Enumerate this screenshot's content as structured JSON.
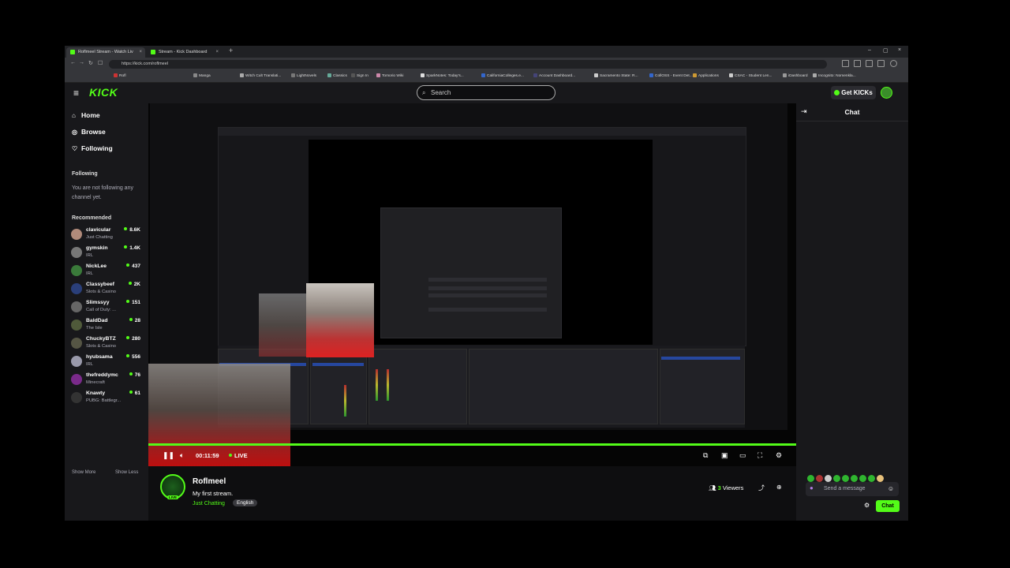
{
  "browser": {
    "tabs": [
      {
        "label": "Roflmeel Stream - Watch Liv"
      },
      {
        "label": "Stream - Kick Dashboard"
      }
    ],
    "new_tab": "+",
    "url": "https://kick.com/roflmeel",
    "window_controls": {
      "minimize": "–",
      "maximize": "▢",
      "close": "×"
    },
    "bookmarks": [
      "Rofl",
      "Manga",
      "Witch Cult Translati...",
      "LightNovels",
      "Classics",
      "Sign In",
      "Tomorio Wiki",
      "SparkNotes: Today's...",
      "CaliforniaColleges.e...",
      "Account Dashboard...",
      "Sacramento State: R...",
      "CollOSS - Event Det...",
      "Applications",
      "CSAC - Student Len...",
      "iDashboard",
      "Incognito: Nomenkla..."
    ]
  },
  "header": {
    "logo": "KICK",
    "search_placeholder": "Search",
    "get_kicks": "Get KICKs"
  },
  "sidebar": {
    "nav": [
      {
        "label": "Home",
        "icon": "home-icon"
      },
      {
        "label": "Browse",
        "icon": "compass-icon"
      },
      {
        "label": "Following",
        "icon": "heart-icon"
      }
    ],
    "following_heading": "Following",
    "following_empty": "You are not following any channel yet.",
    "recommended_heading": "Recommended",
    "recommended": [
      {
        "name": "clavicular",
        "category": "Just Chatting",
        "viewers": "8.6K"
      },
      {
        "name": "gymskin",
        "category": "IRL",
        "viewers": "1.4K"
      },
      {
        "name": "NickLee",
        "category": "IRL",
        "viewers": "437"
      },
      {
        "name": "Classybeef",
        "category": "Slots & Casino",
        "viewers": "2K"
      },
      {
        "name": "Slimssyy",
        "category": "Call of Duty: ...",
        "viewers": "151"
      },
      {
        "name": "BaldDad",
        "category": "The Isle",
        "viewers": "28"
      },
      {
        "name": "ChuckyBTZ",
        "category": "Slots & Casino",
        "viewers": "280"
      },
      {
        "name": "hyubsama",
        "category": "IRL",
        "viewers": "556"
      },
      {
        "name": "thefreddymc",
        "category": "Minecraft",
        "viewers": "76"
      },
      {
        "name": "Knawty",
        "category": "PUBG: Battlegr...",
        "viewers": "61"
      }
    ],
    "show_more": "Show More",
    "show_less": "Show Less"
  },
  "player": {
    "time": "00:11:59",
    "live": "LIVE",
    "progress": 1.0
  },
  "channel": {
    "name": "Roflmeel",
    "live_badge": "LIVE",
    "title": "My first stream.",
    "category": "Just Chatting",
    "language": "English",
    "viewers_count": "3",
    "viewers_label": "Viewers"
  },
  "chat": {
    "title": "Chat",
    "placeholder": "Send a message",
    "send_label": "Chat"
  },
  "colors": {
    "accent": "#53fc18",
    "bg": "#0e0e10",
    "panel": "#18181b"
  }
}
